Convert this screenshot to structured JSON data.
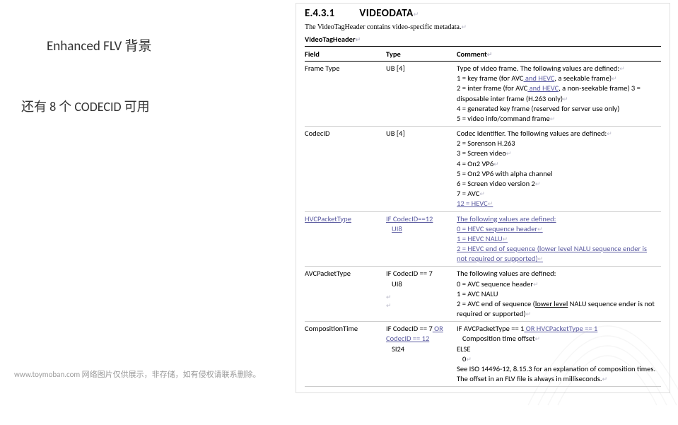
{
  "left": {
    "title": "Enhanced FLV 背景",
    "subtitle": "还有 8 个 CODECID 可用"
  },
  "doc": {
    "sectionNumber": "E.4.3.1",
    "sectionTitle": "VIDEODATA",
    "intro": "The VideoTagHeader contains video-specific metadata.",
    "structName": "VideoTagHeader",
    "headers": {
      "field": "Field",
      "type": "Type",
      "comment": "Comment"
    },
    "rows": {
      "frameType": {
        "field": "Frame Type",
        "type": "UB [4]",
        "comment": {
          "intro": "Type of video frame. The following values are defined:",
          "l1a": "1 = key frame (for AVC",
          "l1b": " and HEVC",
          "l1c": ", a seekable frame)",
          "l2a": "2 = inter frame (for AVC",
          "l2b": " and HEVC",
          "l2c": ", a non-seekable frame)  3 = disposable inter frame (H.263 only)",
          "l4": "4 = generated key frame (reserved for server use only)",
          "l5": "5 = video info/command frame"
        }
      },
      "codecId": {
        "field": "CodecID",
        "type": "UB [4]",
        "comment": {
          "intro": "Codec Identifier. The following values are defined:",
          "l2": "2 = Sorenson H.263",
          "l3": "3 = Screen video",
          "l4": "4 = On2 VP6",
          "l5": "5 = On2 VP6 with alpha channel",
          "l6": "6 = Screen video version 2",
          "l7": "7 = AVC",
          "l12": "12 = HEVC"
        }
      },
      "hvcPacket": {
        "field": "HVCPacketType",
        "type1": "IF CodecID==12",
        "type2": "UI8",
        "comment": {
          "intro": "The following values are defined:",
          "l0": "0 = HEVC sequence header",
          "l1": "1 = HEVC NALU",
          "l2": "2 = HEVC end of sequence (lower level NALU sequence ender is  not required or supported)"
        }
      },
      "avcPacket": {
        "field": "AVCPacketType",
        "type1": "IF CodecID == 7",
        "type2": "UI8",
        "comment": {
          "intro": "The following values are defined:",
          "l0": "0 = AVC sequence header",
          "l1": "1 = AVC NALU",
          "l2a": "2 = AVC end of sequence (",
          "l2b": "lower level",
          "l2c": " NALU sequence ender is not required or supported)"
        }
      },
      "compTime": {
        "field": "CompositionTime",
        "type1a": "IF CodecID == 7",
        "type1b": " OR CodecID == 12",
        "type2": "SI24",
        "comment": {
          "l1a": "IF AVCPacketType  == 1",
          "l1b": " OR HVCPacketType == 1",
          "l2": "Composition time offset",
          "l3": "ELSE",
          "l4": "0",
          "l5": "See ISO 14496-12, 8.15.3 for an explanation of composition times. The offset in an FLV file is always in milliseconds."
        }
      }
    }
  },
  "footer": "www.toymoban.com 网络图片仅供展示，非存储，如有侵权请联系删除。"
}
